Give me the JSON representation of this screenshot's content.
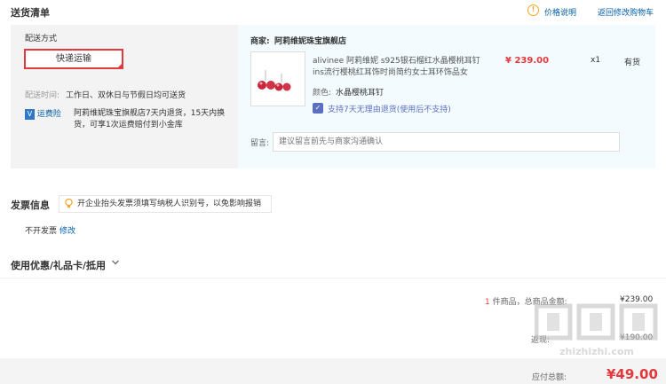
{
  "delivery": {
    "title": "送货清单",
    "price_help": "价格说明",
    "back_to_cart": "返回修改购物车",
    "shipping_method_label": "配送方式",
    "shipping_method_value": "快递运输",
    "delivery_time_label": "配送时间:",
    "delivery_time_value": "工作日、双休日与节假日均可送货",
    "insurance_badge": "运费险",
    "insurance_text_1": "阿莉维妮珠宝旗舰店7天内退货，15天内换",
    "insurance_text_2": "货，可享1次运费赔付到小金库",
    "merchant_label": "商家:",
    "merchant_name": "阿莉维妮珠宝旗舰店",
    "product": {
      "title_1": "alivinee 阿莉维妮 s925银石榴红水晶樱桃耳钉",
      "title_2": "ins流行樱桃红耳饰时尚简约女士耳环饰品女",
      "price": "¥ 239.00",
      "quantity": "x1",
      "stock": "有货",
      "color_label": "颜色:",
      "color_value": "水晶樱桃耳钉",
      "return_policy": "支持7天无理由退货(使用后不支持)"
    },
    "remark_label": "留言:",
    "remark_placeholder": "建议留言前先与商家沟通确认"
  },
  "invoice": {
    "title": "发票信息",
    "tip": "开企业抬头发票须填写纳税人识别号，以免影响报销",
    "status": "不开发票",
    "edit": "修改"
  },
  "discount": {
    "title": "使用优惠/礼品卡/抵用"
  },
  "summary": {
    "count_num": "1",
    "count_text": " 件商品，总商品金额:",
    "total": "¥239.00",
    "line2_label": "返现:",
    "line2_value": "¥190.00",
    "pay_label": "应付总额:",
    "pay_value": "¥49.00"
  },
  "watermark": "zhizhizhi.com",
  "colors": {
    "accent_red": "#e4393c",
    "link_blue": "#005ea7",
    "warning_orange": "#f5a623"
  }
}
